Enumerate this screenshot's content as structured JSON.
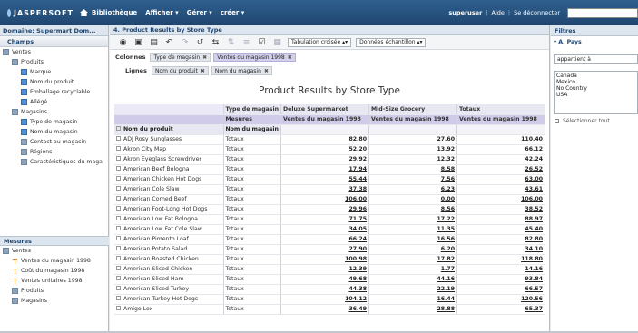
{
  "topbar": {
    "logo": "JASPERSOFT",
    "nav": [
      "Bibliothèque",
      "Afficher",
      "Gérer",
      "créer"
    ],
    "user": "superuser",
    "help": "Aide",
    "logout": "Se déconnecter"
  },
  "left": {
    "domain_title": "Domaine: Supermart Dom...",
    "fields_title": "Champs",
    "tree": [
      {
        "label": "Ventes",
        "level": 0,
        "kind": "folder"
      },
      {
        "label": "Produits",
        "level": 1,
        "kind": "folder"
      },
      {
        "label": "Marque",
        "level": 2,
        "kind": "field"
      },
      {
        "label": "Nom du produit",
        "level": 2,
        "kind": "field"
      },
      {
        "label": "Emballage recyclable",
        "level": 2,
        "kind": "field"
      },
      {
        "label": "Allégé",
        "level": 2,
        "kind": "field"
      },
      {
        "label": "Magasins",
        "level": 1,
        "kind": "folder"
      },
      {
        "label": "Type de magasin",
        "level": 2,
        "kind": "field"
      },
      {
        "label": "Nom du magasin",
        "level": 2,
        "kind": "field"
      },
      {
        "label": "Contact au magasin",
        "level": 2,
        "kind": "folder"
      },
      {
        "label": "Régions",
        "level": 2,
        "kind": "folder"
      },
      {
        "label": "Caractéristiques du maga",
        "level": 2,
        "kind": "folder"
      }
    ],
    "measures_title": "Mesures",
    "measures": [
      {
        "label": "Ventes",
        "level": 0,
        "kind": "folder"
      },
      {
        "label": "Ventes du magasin 1998",
        "level": 1,
        "kind": "meas"
      },
      {
        "label": "Coût du magasin 1998",
        "level": 1,
        "kind": "meas"
      },
      {
        "label": "Ventes unitaires 1998",
        "level": 1,
        "kind": "meas"
      },
      {
        "label": "Produits",
        "level": 1,
        "kind": "folder"
      },
      {
        "label": "Magasins",
        "level": 1,
        "kind": "folder"
      }
    ]
  },
  "main": {
    "title": "4. Product Results by Store Type",
    "toolbar": {
      "tab_select": "Tabulation croisée",
      "data_select": "Données échantillon"
    },
    "columns_label": "Colonnes",
    "columns_chips": [
      "Type de magasin",
      "Ventes du magasin 1998"
    ],
    "rows_label": "Lignes",
    "rows_chips": [
      "Nom du produit",
      "Nom du magasin"
    ],
    "report_title": "Product Results by Store Type",
    "header": {
      "store_type_label": "Type de magasin",
      "measures_label": "Mesures",
      "col_types": [
        "Deluxe Supermarket",
        "Mid-Size Grocery",
        "Totaux"
      ],
      "col_measures": [
        "Ventes du magasin 1998",
        "Ventes du magasin 1998",
        "Ventes du magasin 1998"
      ],
      "row_dim1": "Nom du produit",
      "row_dim2": "Nom du magasin"
    },
    "rows": [
      {
        "name": "ADJ Rosy Sunglasses",
        "store": "Totaux",
        "v": [
          "82.80",
          "27.60",
          "110.40"
        ]
      },
      {
        "name": "Akron City Map",
        "store": "Totaux",
        "v": [
          "52.20",
          "13.92",
          "66.12"
        ]
      },
      {
        "name": "Akron Eyeglass Screwdriver",
        "store": "Totaux",
        "v": [
          "29.92",
          "12.32",
          "42.24"
        ]
      },
      {
        "name": "American Beef Bologna",
        "store": "Totaux",
        "v": [
          "17.94",
          "8.58",
          "26.52"
        ]
      },
      {
        "name": "American Chicken Hot Dogs",
        "store": "Totaux",
        "v": [
          "55.44",
          "7.56",
          "63.00"
        ]
      },
      {
        "name": "American Cole Slaw",
        "store": "Totaux",
        "v": [
          "37.38",
          "6.23",
          "43.61"
        ]
      },
      {
        "name": "American Corned Beef",
        "store": "Totaux",
        "v": [
          "106.00",
          "0.00",
          "106.00"
        ]
      },
      {
        "name": "American Foot-Long Hot Dogs",
        "store": "Totaux",
        "v": [
          "29.96",
          "8.56",
          "38.52"
        ]
      },
      {
        "name": "American Low Fat Bologna",
        "store": "Totaux",
        "v": [
          "71.75",
          "17.22",
          "88.97"
        ]
      },
      {
        "name": "American Low Fat Cole Slaw",
        "store": "Totaux",
        "v": [
          "34.05",
          "11.35",
          "45.40"
        ]
      },
      {
        "name": "American Pimento Loaf",
        "store": "Totaux",
        "v": [
          "66.24",
          "16.56",
          "82.80"
        ]
      },
      {
        "name": "American Potato Salad",
        "store": "Totaux",
        "v": [
          "27.90",
          "6.20",
          "34.10"
        ]
      },
      {
        "name": "American Roasted Chicken",
        "store": "Totaux",
        "v": [
          "100.98",
          "17.82",
          "118.80"
        ]
      },
      {
        "name": "American Sliced Chicken",
        "store": "Totaux",
        "v": [
          "12.39",
          "1.77",
          "14.16"
        ]
      },
      {
        "name": "American Sliced Ham",
        "store": "Totaux",
        "v": [
          "49.68",
          "44.16",
          "93.84"
        ]
      },
      {
        "name": "American Sliced Turkey",
        "store": "Totaux",
        "v": [
          "44.38",
          "22.19",
          "66.57"
        ]
      },
      {
        "name": "American Turkey Hot Dogs",
        "store": "Totaux",
        "v": [
          "104.12",
          "16.44",
          "120.56"
        ]
      },
      {
        "name": "Amigo Lox",
        "store": "Totaux",
        "v": [
          "36.49",
          "28.88",
          "65.37"
        ]
      }
    ]
  },
  "right": {
    "title": "Filtres",
    "filter_name": "A. Pays",
    "operator": "appartient à",
    "options": [
      "Canada",
      "Mexico",
      "No Country",
      "USA"
    ],
    "select_all": "Sélectionner tout"
  }
}
